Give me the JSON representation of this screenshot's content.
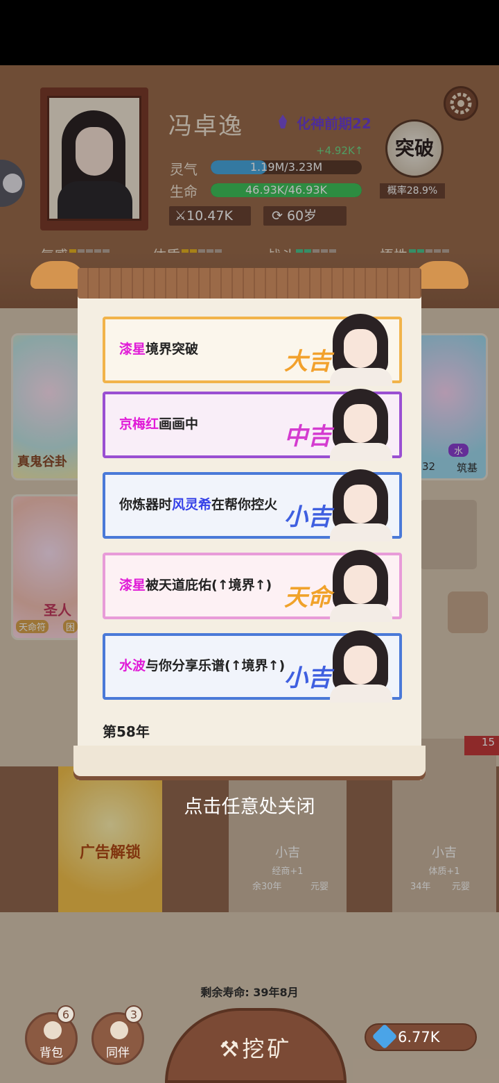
{
  "player": {
    "name": "冯卓逸",
    "realm": "化神前期22",
    "spirit_gain": "+4.92K↑",
    "spirit_label": "灵气",
    "spirit_text": "1.19M/3.23M",
    "spirit_fraction": 0.37,
    "life_label": "生命",
    "life_text": "46.93K/46.93K",
    "life_fraction": 1.0,
    "power": "10.47K",
    "age": "60岁",
    "breakthrough_label": "突破",
    "breakthrough_rate": "概率28.9%"
  },
  "attributes": [
    {
      "label": "气感",
      "level": 1,
      "color": "#e8b321"
    },
    {
      "label": "体质",
      "level": 2,
      "color": "#e8b321"
    },
    {
      "label": "战斗",
      "level": 2,
      "color": "#4cc58f"
    },
    {
      "label": "悟性",
      "level": 2,
      "color": "#4cc58f"
    }
  ],
  "background_cards": {
    "left_top_title": "真鬼谷卦",
    "left_bottom_title": "圣人",
    "left_bottom_tag1": "天命符",
    "left_bottom_tag2": "困",
    "right_top_tag": "水",
    "right_top_num": "32",
    "right_top_realm": "筑基"
  },
  "events": [
    {
      "prefix": "",
      "name": "漆星",
      "suffix": "境界突破",
      "stamp": "大吉",
      "name_color": "#e01bd7",
      "stamp_color": "#f2a12c",
      "border": "#f1b34a",
      "bg": "#fbf6ec"
    },
    {
      "prefix": "",
      "name": "京梅红",
      "suffix": "画画中",
      "stamp": "中吉",
      "name_color": "#e01bd7",
      "stamp_color": "#d43bd0",
      "border": "#9a4fd2",
      "bg": "#f9eef8"
    },
    {
      "prefix": "你炼器时",
      "name": "风灵希",
      "suffix": "在帮你控火",
      "stamp": "小吉",
      "name_color": "#3541e8",
      "stamp_color": "#3f5fe0",
      "border": "#4a79d8",
      "bg": "#f1f4fb"
    },
    {
      "prefix": "",
      "name": "漆星",
      "suffix": "被天道庇佑(↑境界↑)",
      "stamp": "天命",
      "name_color": "#e01bd7",
      "stamp_color": "#f0a22a",
      "border": "#e89bd8",
      "bg": "#fdf1f4"
    },
    {
      "prefix": "",
      "name": "水波",
      "suffix": "与你分享乐谱(↑境界↑)",
      "stamp": "小吉",
      "name_color": "#e01bd7",
      "stamp_color": "#3f5fe0",
      "border": "#4a79d8",
      "bg": "#f1f4fb"
    }
  ],
  "year_label": "第58年",
  "close_hint": "点击任意处关闭",
  "shelf": {
    "ad_label": "广告解锁",
    "card1_title": "小吉",
    "card1_tag": "经商+1",
    "card1_foot": "余30年",
    "card1_realm": "元婴",
    "card2_title": "小吉",
    "card2_tag": "体质+1",
    "card2_foot": "34年",
    "card2_realm": "元婴",
    "corner_num": "15"
  },
  "lifespan": "剩余寿命: 39年8月",
  "bottom": {
    "bag_label": "背包",
    "bag_count": "6",
    "partner_label": "同伴",
    "partner_count": "3",
    "mine_label": "挖矿",
    "gems": "6.77K"
  }
}
